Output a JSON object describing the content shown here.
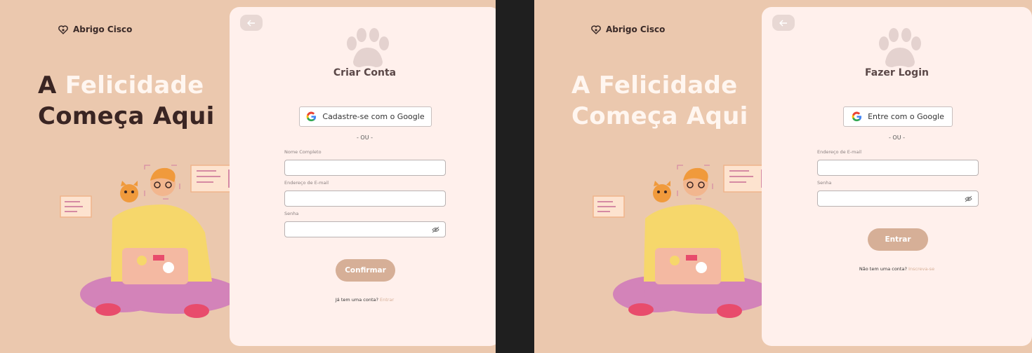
{
  "brand": {
    "name": "Abrigo Cisco"
  },
  "headline": {
    "line1_a": "A ",
    "line1_b": "Felicidade",
    "line2": "Começa Aqui"
  },
  "signup": {
    "title": "Criar Conta",
    "google_label": "Cadastre-se com o Google",
    "or": "- OU -",
    "name_label": "Nome Completo",
    "email_label": "Endereço de E-mail",
    "password_label": "Senha",
    "submit": "Confirmar",
    "footer_text": "Já tem uma conta?",
    "footer_link": "Entrar"
  },
  "login": {
    "title": "Fazer Login",
    "google_label": "Entre com o Google",
    "or": "- OU -",
    "email_label": "Endereço de  E-mail",
    "password_label": "Senha",
    "submit": "Entrar",
    "footer_text": "Não tem uma conta?",
    "footer_link": "Inscreva-se"
  },
  "colors": {
    "left_bg": "#ebc8ae",
    "card_bg": "#fff0ec",
    "accent": "#d6af97",
    "dark_text": "#3a2523"
  }
}
